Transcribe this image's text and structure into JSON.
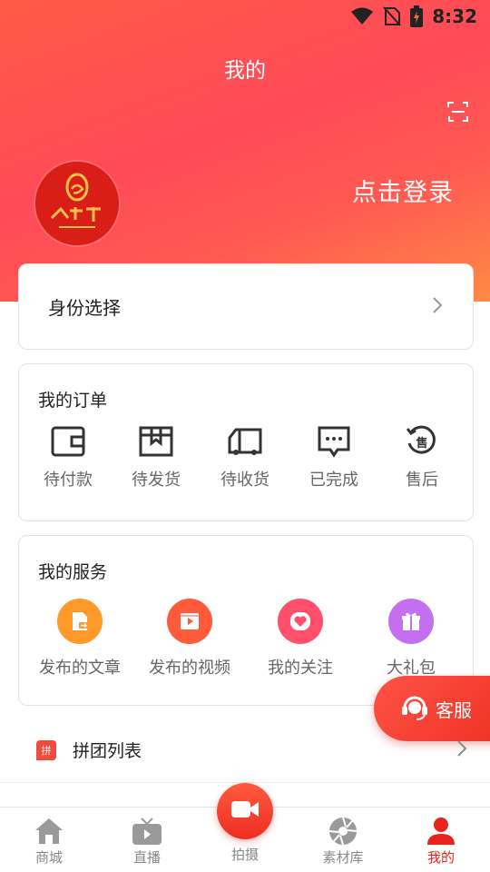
{
  "status_bar": {
    "time": "8:32"
  },
  "page": {
    "title": "我的"
  },
  "profile": {
    "login_text": "点击登录",
    "avatar_text": "鲁国年千"
  },
  "identity": {
    "label": "身份选择"
  },
  "orders": {
    "title": "我的订单",
    "items": [
      {
        "label": "待付款",
        "icon": "wallet-icon"
      },
      {
        "label": "待发货",
        "icon": "package-icon"
      },
      {
        "label": "待收货",
        "icon": "truck-icon"
      },
      {
        "label": "已完成",
        "icon": "chat-complete-icon"
      },
      {
        "label": "售后",
        "icon": "after-sale-icon",
        "icon_text": "售"
      }
    ]
  },
  "services": {
    "title": "我的服务",
    "items": [
      {
        "label": "发布的文章",
        "icon": "article-icon",
        "color": "#ff9a2a"
      },
      {
        "label": "发布的视频",
        "icon": "video-icon",
        "color": "#ff5a3a"
      },
      {
        "label": "我的关注",
        "icon": "heart-icon",
        "color": "#ff4f6a"
      },
      {
        "label": "大礼包",
        "icon": "gift-icon",
        "color": "#c46ef0"
      }
    ]
  },
  "customer_service": {
    "label": "客服"
  },
  "group_list": {
    "label": "拼团列表",
    "icon_text": "拼"
  },
  "bottom_nav": {
    "items": [
      {
        "label": "商城",
        "icon": "home-icon"
      },
      {
        "label": "直播",
        "icon": "tv-icon"
      },
      {
        "label": "拍摄",
        "icon": "camera-icon"
      },
      {
        "label": "素材库",
        "icon": "aperture-icon"
      },
      {
        "label": "我的",
        "icon": "user-icon",
        "active": true
      }
    ]
  },
  "colors": {
    "accent": "#e8231a",
    "header_gradient_start": "#ff5a46",
    "header_gradient_end": "#ff8a45"
  }
}
